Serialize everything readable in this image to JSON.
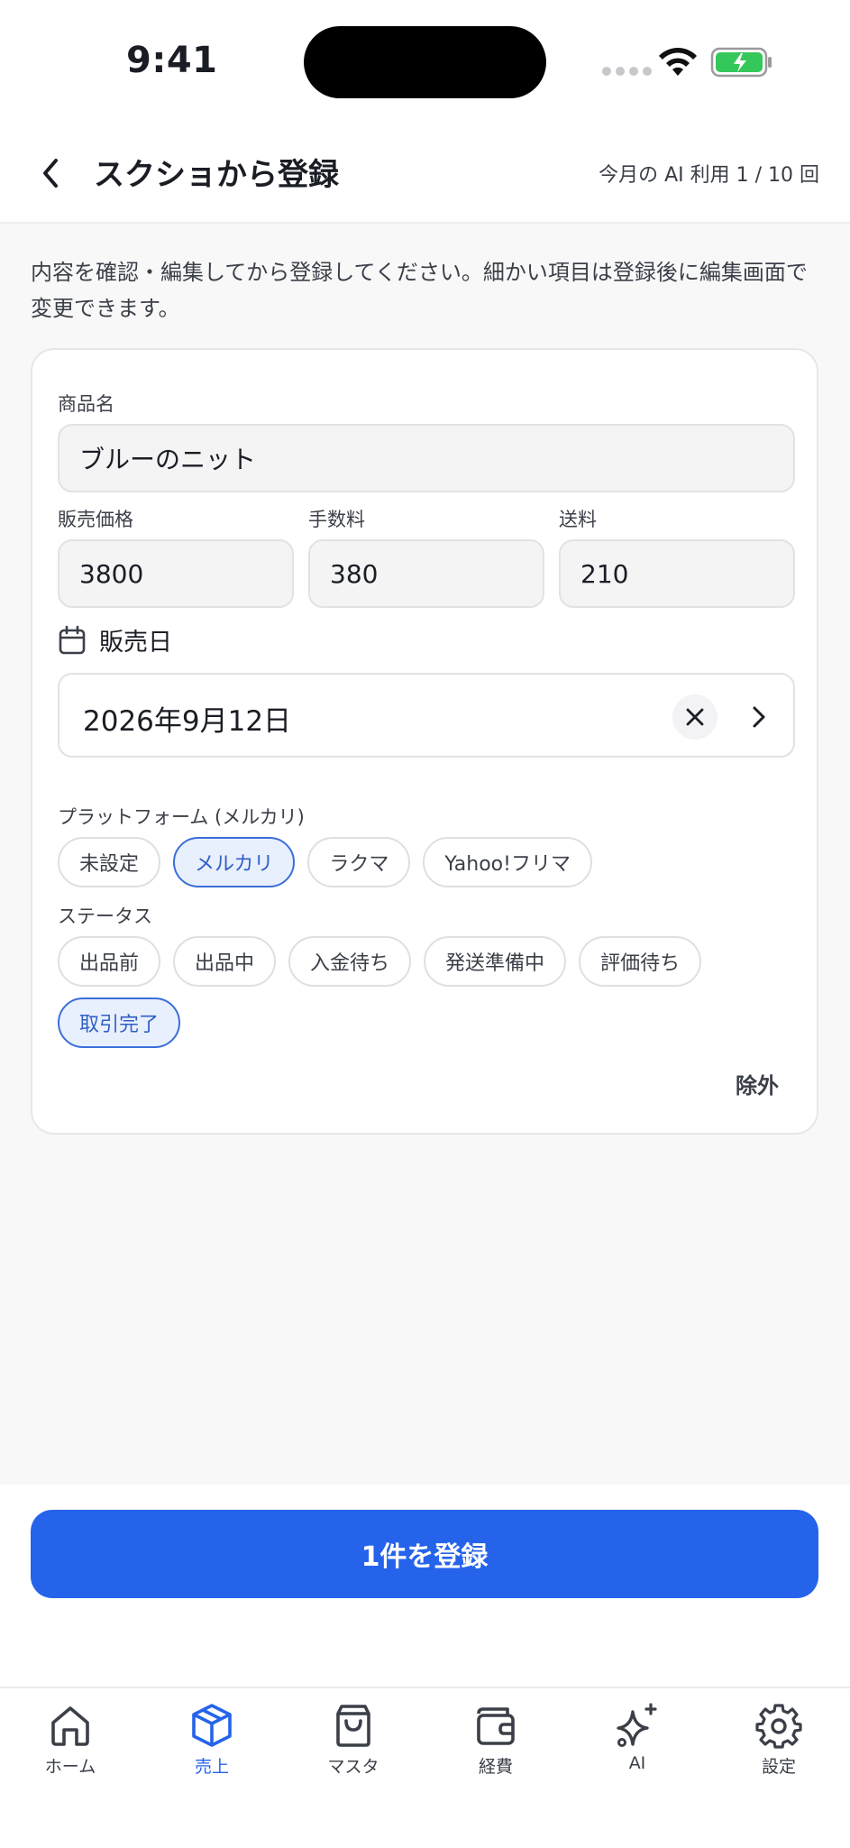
{
  "status": {
    "time": "9:41"
  },
  "header": {
    "title": "スクショから登録",
    "quota": "今月の AI 利用 1 / 10 回"
  },
  "intro": "内容を確認・編集してから登録してください。細かい項目は登録後に編集画面で変更できます。",
  "form": {
    "name_label": "商品名",
    "name_value": "ブルーのニット",
    "price_label": "販売価格",
    "price_value": "3800",
    "fee_label": "手数料",
    "fee_value": "380",
    "shipping_label": "送料",
    "shipping_value": "210",
    "date_label": "販売日",
    "date_value": "2026年9月12日",
    "platform_label": "プラットフォーム (メルカリ)",
    "platforms": [
      "未設定",
      "メルカリ",
      "ラクマ",
      "Yahoo!フリマ"
    ],
    "platform_selected": "メルカリ",
    "status_label": "ステータス",
    "statuses": [
      "出品前",
      "出品中",
      "入金待ち",
      "発送準備中",
      "評価待ち",
      "取引完了"
    ],
    "status_selected": "取引完了",
    "exclude_label": "除外"
  },
  "submit_label": "1件を登録",
  "tabs": [
    {
      "label": "ホーム",
      "icon": "home-icon"
    },
    {
      "label": "売上",
      "icon": "box-icon",
      "active": true
    },
    {
      "label": "マスタ",
      "icon": "bag-icon"
    },
    {
      "label": "経費",
      "icon": "wallet-icon"
    },
    {
      "label": "AI",
      "icon": "sparkle-icon"
    },
    {
      "label": "設定",
      "icon": "gear-icon"
    }
  ],
  "colors": {
    "accent": "#2563eb",
    "chip_selected_bg": "#e9f0fd",
    "battery": "#34c759"
  }
}
